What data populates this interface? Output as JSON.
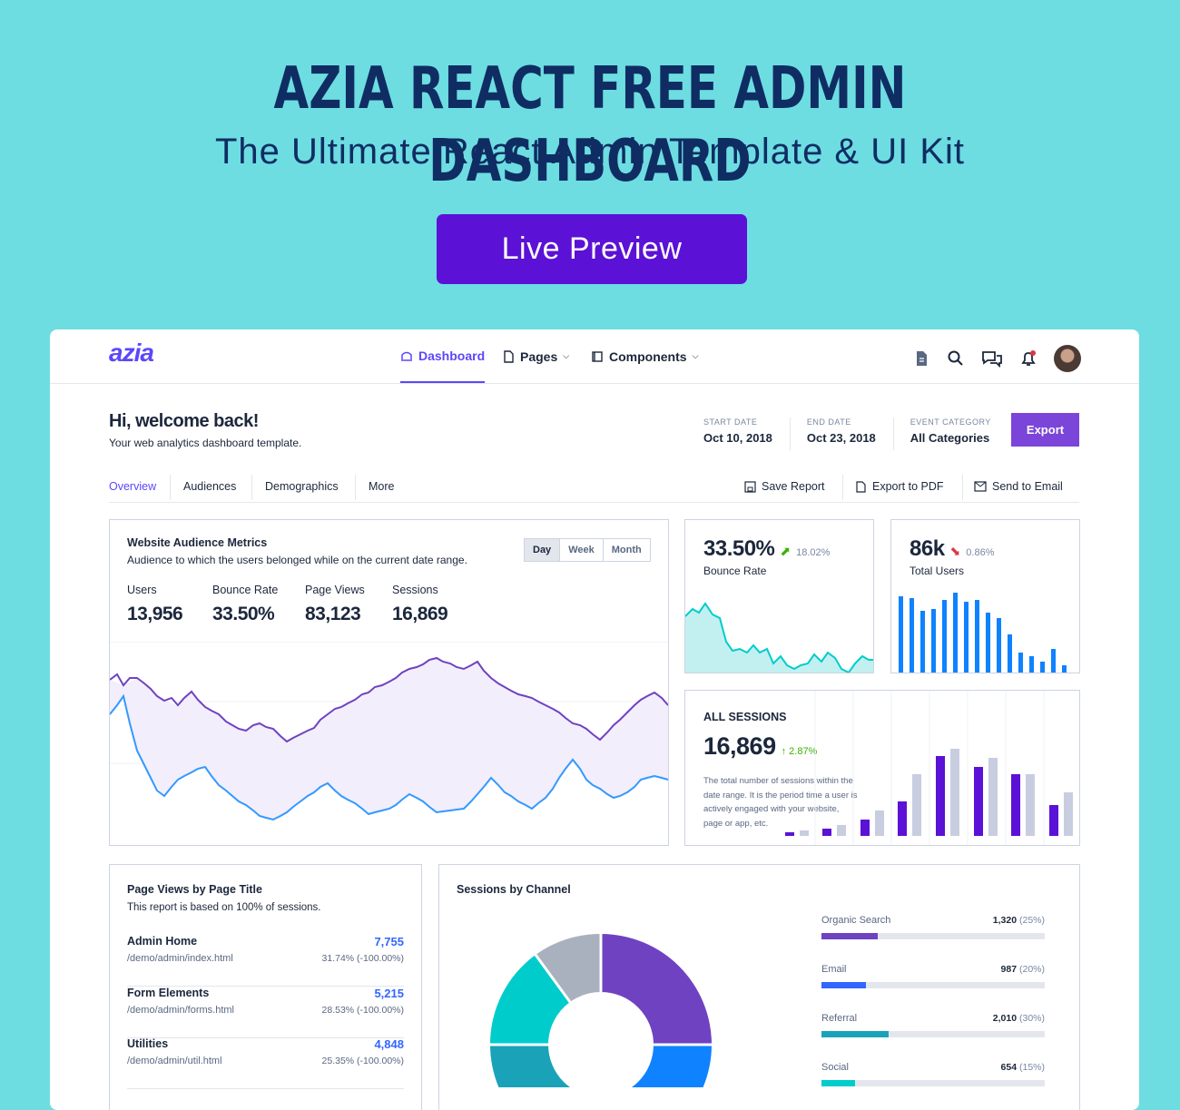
{
  "hero": {
    "title": "AZIA REACT FREE ADMIN DASHBOARD",
    "subtitle": "The Ultimate React Admin Template & UI Kit",
    "button_label": "Live Preview"
  },
  "topbar": {
    "logo": "azia",
    "nav": [
      {
        "label": "Dashboard",
        "icon": "dashboard-icon",
        "active": true
      },
      {
        "label": "Pages",
        "icon": "file-icon",
        "active": false
      },
      {
        "label": "Components",
        "icon": "box-icon",
        "active": false
      }
    ],
    "icons": [
      "document-icon",
      "search-icon",
      "chat-icon",
      "bell-icon",
      "avatar"
    ]
  },
  "header": {
    "welcome": "Hi, welcome back!",
    "welcome_sub": "Your web analytics dashboard template.",
    "filters": [
      {
        "label": "START DATE",
        "value": "Oct 10, 2018"
      },
      {
        "label": "END DATE",
        "value": "Oct 23, 2018"
      },
      {
        "label": "EVENT CATEGORY",
        "value": "All Categories"
      }
    ],
    "export_label": "Export"
  },
  "tabs": {
    "items": [
      "Overview",
      "Audiences",
      "Demographics",
      "More"
    ],
    "tools": [
      "Save Report",
      "Export to PDF",
      "Send to Email"
    ]
  },
  "audience": {
    "title": "Website Audience Metrics",
    "subtitle": "Audience to which the users belonged while on the current date range.",
    "ranges": [
      "Day",
      "Week",
      "Month"
    ],
    "metrics": [
      {
        "label": "Users",
        "value": "13,956"
      },
      {
        "label": "Bounce Rate",
        "value": "33.50%"
      },
      {
        "label": "Page Views",
        "value": "83,123"
      },
      {
        "label": "Sessions",
        "value": "16,869"
      }
    ]
  },
  "bounce": {
    "value": "33.50%",
    "change": "18.02%",
    "label": "Bounce Rate"
  },
  "users": {
    "value": "86k",
    "change": "0.86%",
    "label": "Total Users"
  },
  "sessions": {
    "title": "ALL SESSIONS",
    "value": "16,869",
    "change": "↑ 2.87%",
    "desc": "The total number of sessions within the date range. It is the period time a user is actively engaged with your website, page or app, etc."
  },
  "pageviews": {
    "title": "Page Views by Page Title",
    "subtitle": "This report is based on 100% of sessions.",
    "rows": [
      {
        "title": "Admin Home",
        "path": "/demo/admin/index.html",
        "value": "7,755",
        "pct": "31.74% (-100.00%)"
      },
      {
        "title": "Form Elements",
        "path": "/demo/admin/forms.html",
        "value": "5,215",
        "pct": "28.53% (-100.00%)"
      },
      {
        "title": "Utilities",
        "path": "/demo/admin/util.html",
        "value": "4,848",
        "pct": "25.35% (-100.00%)"
      }
    ]
  },
  "channels": {
    "title": "Sessions by Channel",
    "items": [
      {
        "name": "Organic Search",
        "value": "1,320",
        "pct": "(25%)",
        "fill": 0.25,
        "color": "#6f42c1"
      },
      {
        "name": "Email",
        "value": "987",
        "pct": "(20%)",
        "fill": 0.2,
        "color": "#3366ff"
      },
      {
        "name": "Referral",
        "value": "2,010",
        "pct": "(30%)",
        "fill": 0.3,
        "color": "#1aa3b8"
      },
      {
        "name": "Social",
        "value": "654",
        "pct": "(15%)",
        "fill": 0.15,
        "color": "#00cccc"
      }
    ]
  }
}
